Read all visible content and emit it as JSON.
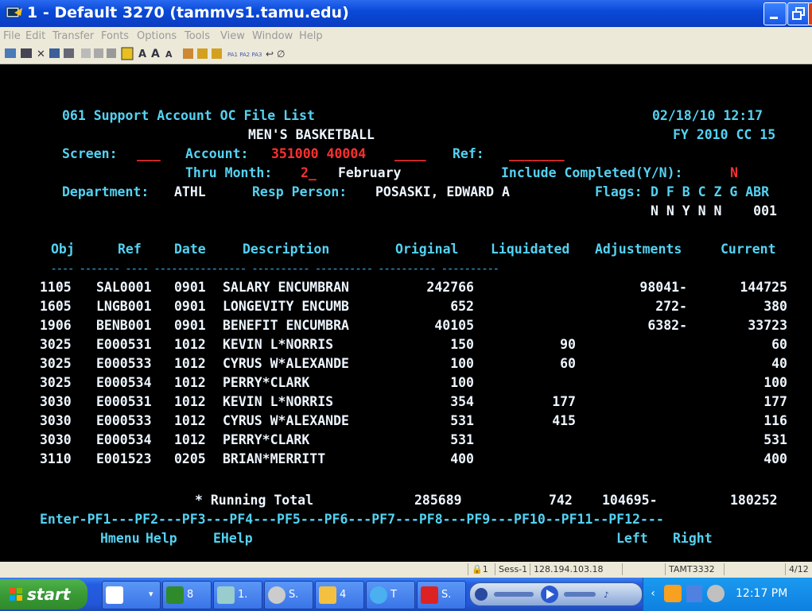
{
  "window": {
    "title": "1 - Default 3270 (tammvs1.tamu.edu)",
    "menu": [
      "File",
      "Edit",
      "Transfer",
      "Fonts",
      "Options",
      "Tools",
      "View",
      "Window",
      "Help"
    ],
    "toolbar_pf": "PA1 PA2 PA3"
  },
  "header": {
    "title": "061 Support Account OC File List",
    "datetime": "02/18/10 12:17",
    "subtitle": "MEN'S BASKETBALL",
    "fy": "FY 2010 CC 15",
    "screen_label": "Screen:",
    "screen_value": "___",
    "account_label": "Account:",
    "account_value": "351000 40004",
    "account_blank": "____",
    "ref_label": "Ref:",
    "ref_value": "_______",
    "thru_label": "Thru Month:",
    "thru_value": "2_",
    "thru_month_name": "February",
    "include_label": "Include Completed(Y/N):",
    "include_value": "N",
    "dept_label": "Department:",
    "dept_value": "ATHL",
    "resp_label": "Resp Person:",
    "resp_value": "POSASKI, EDWARD A",
    "flags_label": "Flags:",
    "flags_header": "D F B C Z G ABR",
    "flags_values": "N N Y N N    001"
  },
  "table": {
    "headers": [
      "Obj",
      "Ref",
      "Date",
      "Description",
      "Original",
      "Liquidated",
      "Adjustments",
      "Current"
    ],
    "dashes": "---- ------- ---- ---------------- ---------- ---------- ---------- ----------",
    "rows": [
      {
        "obj": "1105",
        "ref": "SAL0001",
        "date": "0901",
        "desc": "SALARY ENCUMBRAN",
        "orig": "242766",
        "liq": "",
        "adj": "98041-",
        "cur": "144725"
      },
      {
        "obj": "1605",
        "ref": "LNGB001",
        "date": "0901",
        "desc": "LONGEVITY ENCUMB",
        "orig": "652",
        "liq": "",
        "adj": "272-",
        "cur": "380"
      },
      {
        "obj": "1906",
        "ref": "BENB001",
        "date": "0901",
        "desc": "BENEFIT ENCUMBRA",
        "orig": "40105",
        "liq": "",
        "adj": "6382-",
        "cur": "33723"
      },
      {
        "obj": "3025",
        "ref": "E000531",
        "date": "1012",
        "desc": "KEVIN L*NORRIS",
        "orig": "150",
        "liq": "90",
        "adj": "",
        "cur": "60"
      },
      {
        "obj": "3025",
        "ref": "E000533",
        "date": "1012",
        "desc": "CYRUS W*ALEXANDE",
        "orig": "100",
        "liq": "60",
        "adj": "",
        "cur": "40"
      },
      {
        "obj": "3025",
        "ref": "E000534",
        "date": "1012",
        "desc": "PERRY*CLARK",
        "orig": "100",
        "liq": "",
        "adj": "",
        "cur": "100"
      },
      {
        "obj": "3030",
        "ref": "E000531",
        "date": "1012",
        "desc": "KEVIN L*NORRIS",
        "orig": "354",
        "liq": "177",
        "adj": "",
        "cur": "177"
      },
      {
        "obj": "3030",
        "ref": "E000533",
        "date": "1012",
        "desc": "CYRUS W*ALEXANDE",
        "orig": "531",
        "liq": "415",
        "adj": "",
        "cur": "116"
      },
      {
        "obj": "3030",
        "ref": "E000534",
        "date": "1012",
        "desc": "PERRY*CLARK",
        "orig": "531",
        "liq": "",
        "adj": "",
        "cur": "531"
      },
      {
        "obj": "3110",
        "ref": "E001523",
        "date": "0205",
        "desc": "BRIAN*MERRITT",
        "orig": "400",
        "liq": "",
        "adj": "",
        "cur": "400"
      }
    ],
    "total_label": "* Running Total",
    "total_orig": "285689",
    "total_liq": "742",
    "total_adj": "104695-",
    "total_cur": "180252"
  },
  "pfkeys": {
    "line": "Enter-PF1---PF2---PF3---PF4---PF5---PF6---PF7---PF8---PF9---PF10--PF11--PF12---",
    "hmenu": "Hmenu",
    "help": "Help",
    "ehelp": "EHelp",
    "left": "Left",
    "right": "Right"
  },
  "statusbar": {
    "session_num": "1",
    "session": "Sess-1",
    "ip": "128.194.103.18",
    "terminal": "TAMT3332",
    "position": "4/12"
  },
  "taskbar": {
    "start": "start",
    "tasks": [
      {
        "label": "",
        "icon": "word-icon"
      },
      {
        "label": "8",
        "icon": "excel-icon"
      },
      {
        "label": "1.",
        "icon": "terminal-icon"
      },
      {
        "label": "S.",
        "icon": "chrome-icon"
      },
      {
        "label": "4",
        "icon": "outlook-icon"
      },
      {
        "label": "T",
        "icon": "ie-icon"
      },
      {
        "label": "S.",
        "icon": "acrobat-icon"
      }
    ],
    "clock": "12:17 PM"
  }
}
